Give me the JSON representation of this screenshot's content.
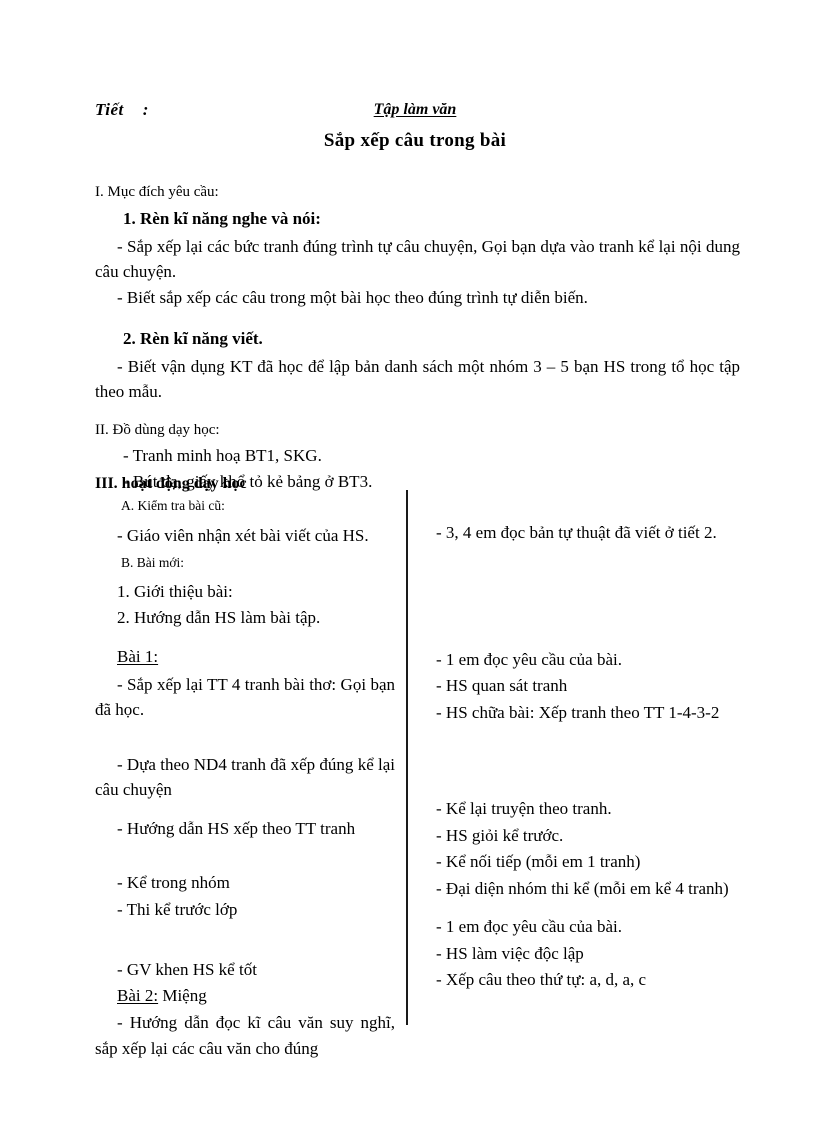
{
  "header": {
    "tiet_label": "Tiết    :",
    "subject": "Tập làm văn",
    "lesson_title": "Sắp xếp câu trong  bài"
  },
  "section_I": {
    "heading": "I. Mục đích  yêu cầu:",
    "sub1_heading": "1. Rèn kĩ năng nghe và nói:",
    "sub1_items": [
      "- Sắp xếp lại  các bức tranh đúng trình tự câu chuyện, Gọi bạn dựa vào tranh kể lại nội dung câu chuyện.",
      "- Biết sắp xếp các câu trong một bài học theo đúng trình tự diễn biến."
    ],
    "sub2_heading": "2. Rèn kĩ năng viết.",
    "sub2_items": [
      "- Biết vận dụng KT đã học để lập bản danh sách một nhóm 3 – 5 bạn HS trong tổ học tập theo mẫu."
    ]
  },
  "section_II": {
    "heading": "II. Đồ dùng  dạy học:",
    "items": [
      "- Tranh minh  hoạ BT1, SKG.",
      "- Bút dạ, giấy  khổ tỏ kẻ bảng ở BT3."
    ]
  },
  "section_III": {
    "heading": "III. hoạt động dạy học",
    "left_column": [
      {
        "kind": "small",
        "text": "A. Kiểm tra bài cũ:"
      },
      {
        "kind": "justified",
        "text": "- Giáo viên nhận xét bài viết của HS."
      },
      {
        "kind": "small",
        "text": "B. Bài mới:"
      },
      {
        "kind": "num",
        "text": "1. Giới thiệu bài:"
      },
      {
        "kind": "num",
        "text": "2. Hướng dẫn HS làm bài tập."
      },
      {
        "kind": "bai",
        "underlined": "Bài 1:",
        "rest": ""
      },
      {
        "kind": "justified",
        "text": "- Sắp xếp lại TT 4 tranh bài thơ: Gọi bạn đã học."
      },
      {
        "kind": "justified",
        "text": "- Dựa theo ND4 tranh  đã xếp đúng kể lại  câu chuyện"
      },
      {
        "kind": "plain",
        "text": "- Hướng dẫn HS xếp theo TT tranh"
      },
      {
        "kind": "plain",
        "text": "- Kể trong nhóm"
      },
      {
        "kind": "plain",
        "text": "- Thi kể trước lớp"
      },
      {
        "kind": "plain",
        "text": "- GV khen HS kể tốt"
      },
      {
        "kind": "bai",
        "underlined": "Bài 2:",
        "rest": "  Miệng"
      },
      {
        "kind": "justified",
        "text": "- Hướng dẫn đọc kĩ câu văn suy nghĩ, sắp xếp lại các câu văn cho đúng"
      }
    ],
    "right_column": [
      "- 3, 4 em đọc bản tự thuật đã viết ở tiết 2.",
      "- 1 em đọc yêu cầu của bài.",
      "- HS quan sát tranh",
      "- HS chữa bài: Xếp tranh theo TT 1-4-3-2",
      "- Kể lại  truyện theo tranh.",
      "- HS giỏi kể trước.",
      "- Kể nối tiếp (mỗi em 1 tranh)",
      "- Đại diện nhóm thi kể (mỗi em kể 4 tranh)",
      "- 1 em đọc yêu cầu của bài.",
      "- HS làm việc độc lập",
      "- Xếp câu theo thứ tự: a, d, a, c"
    ]
  }
}
